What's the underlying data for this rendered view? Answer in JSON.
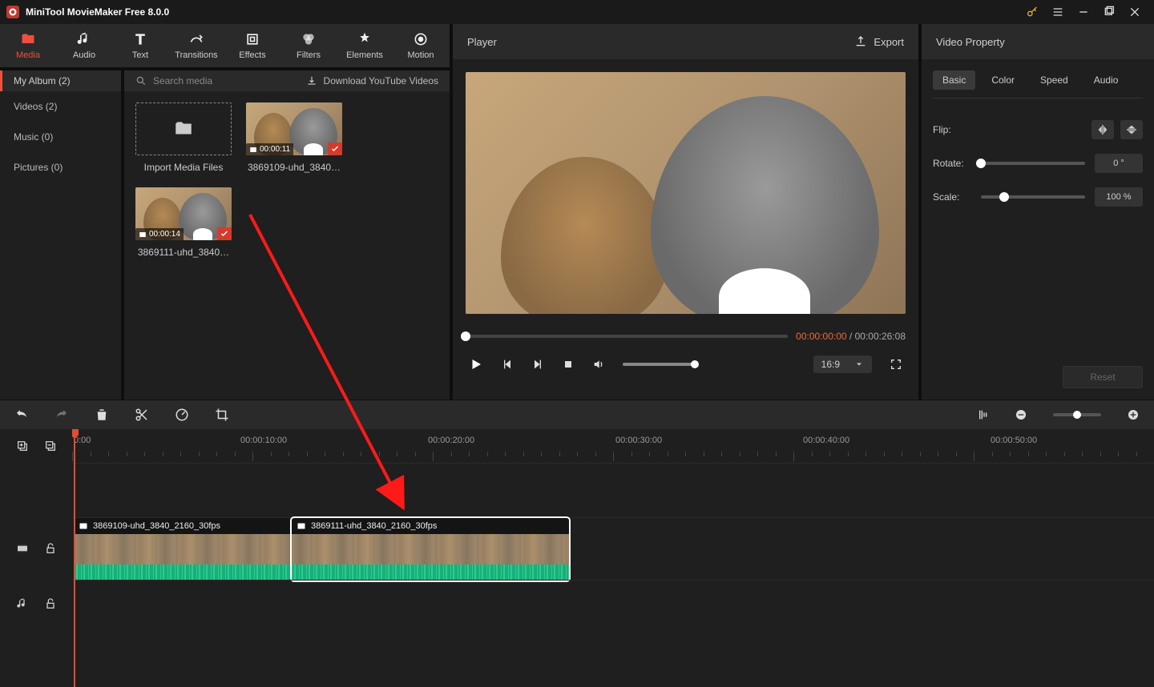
{
  "app_title": "MiniTool MovieMaker Free 8.0.0",
  "tabs": {
    "media": "Media",
    "audio": "Audio",
    "text": "Text",
    "trans": "Transitions",
    "effects": "Effects",
    "filters": "Filters",
    "elements": "Elements",
    "motion": "Motion"
  },
  "sidebar": {
    "header": "My Album (2)",
    "items": [
      "Videos (2)",
      "Music (0)",
      "Pictures (0)"
    ]
  },
  "library": {
    "search_placeholder": "Search media",
    "download_label": "Download YouTube Videos",
    "import_label": "Import Media Files",
    "clips": [
      {
        "name": "3869109-uhd_3840…",
        "duration": "00:00:11"
      },
      {
        "name": "3869111-uhd_3840…",
        "duration": "00:00:14"
      }
    ]
  },
  "player": {
    "title": "Player",
    "export": "Export",
    "current_time": "00:00:00:00",
    "total_time": "00:00:26:08",
    "aspect": "16:9"
  },
  "property": {
    "title": "Video Property",
    "tabs": {
      "basic": "Basic",
      "color": "Color",
      "speed": "Speed",
      "audio": "Audio"
    },
    "flip_label": "Flip:",
    "rotate_label": "Rotate:",
    "rotate_value": "0 °",
    "scale_label": "Scale:",
    "scale_value": "100 %",
    "reset": "Reset"
  },
  "ruler": {
    "labels": [
      "0:00",
      "00:00:10:00",
      "00:00:20:00",
      "00:00:30:00",
      "00:00:40:00",
      "00:00:50:00"
    ]
  },
  "timeline": {
    "clips": [
      {
        "name": "3869109-uhd_3840_2160_30fps"
      },
      {
        "name": "3869111-uhd_3840_2160_30fps"
      }
    ]
  }
}
